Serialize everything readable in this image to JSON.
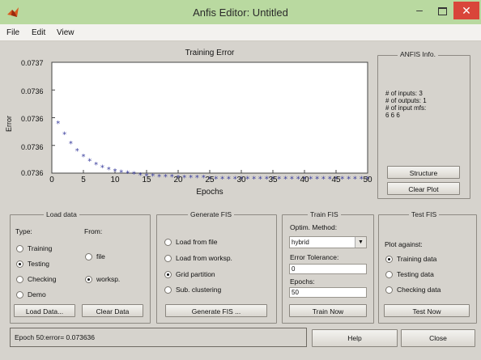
{
  "window": {
    "title": "Anfis Editor: Untitled"
  },
  "menu": [
    "File",
    "Edit",
    "View"
  ],
  "plot": {
    "title": "Training Error",
    "xlabel": "Epochs",
    "ylabel": "Error",
    "ytick_labels": [
      "0.0737",
      "0.0736",
      "0.0736",
      "0.0736",
      "0.0736"
    ],
    "xtick_labels": [
      "0",
      "5",
      "10",
      "15",
      "20",
      "25",
      "30",
      "35",
      "40",
      "45",
      "50"
    ]
  },
  "chart_data": {
    "type": "scatter",
    "title": "Training Error",
    "xlabel": "Epochs",
    "ylabel": "Error",
    "xlim": [
      0,
      50
    ],
    "ylim": [
      0.07358,
      0.0737
    ],
    "x": [
      1,
      2,
      3,
      4,
      5,
      6,
      7,
      8,
      9,
      10,
      11,
      12,
      13,
      14,
      15,
      16,
      17,
      18,
      19,
      20,
      21,
      22,
      23,
      24,
      25,
      26,
      27,
      28,
      29,
      30,
      31,
      32,
      33,
      34,
      35,
      36,
      37,
      38,
      39,
      40,
      41,
      42,
      43,
      44,
      45,
      46,
      47,
      48,
      49,
      50
    ],
    "y": [
      0.073634,
      0.073622,
      0.073612,
      0.073604,
      0.073598,
      0.073593,
      0.073589,
      0.073586,
      0.073584,
      0.073582,
      0.073581,
      0.07358,
      0.073579,
      0.073578,
      0.073577,
      0.073577,
      0.073576,
      0.073576,
      0.073576,
      0.073575,
      0.073575,
      0.073575,
      0.073575,
      0.073575,
      0.073574,
      0.073574,
      0.073574,
      0.073574,
      0.073574,
      0.073574,
      0.073574,
      0.073574,
      0.073574,
      0.073574,
      0.073574,
      0.073574,
      0.073574,
      0.073574,
      0.073574,
      0.073574,
      0.073574,
      0.073574,
      0.073574,
      0.073574,
      0.073574,
      0.073574,
      0.073574,
      0.073574,
      0.073574,
      0.073574
    ],
    "marker": "*",
    "color": "#3b3f9e",
    "grid": false
  },
  "anfis_info": {
    "title": "ANFIS Info.",
    "lines": [
      "# of inputs: 3",
      "# of outputs: 1",
      "# of input mfs:",
      "6 6 6"
    ],
    "structure_label": "Structure",
    "clear_plot_label": "Clear Plot"
  },
  "load_data": {
    "title": "Load data",
    "type_label": "Type:",
    "from_label": "From:",
    "types": [
      "Training",
      "Testing",
      "Checking",
      "Demo"
    ],
    "selected_type": "Testing",
    "from": [
      "file",
      "worksp."
    ],
    "selected_from": "worksp.",
    "load_label": "Load Data...",
    "clear_label": "Clear Data"
  },
  "generate_fis": {
    "title": "Generate FIS",
    "options": [
      "Load from file",
      "Load from worksp.",
      "Grid partition",
      "Sub. clustering"
    ],
    "selected": "Grid partition",
    "button_label": "Generate FIS ..."
  },
  "train_fis": {
    "title": "Train FIS",
    "method_label": "Optim. Method:",
    "method_value": "hybrid",
    "tolerance_label": "Error Tolerance:",
    "tolerance_value": "0",
    "epochs_label": "Epochs:",
    "epochs_value": "50",
    "button_label": "Train Now"
  },
  "test_fis": {
    "title": "Test FIS",
    "plot_against_label": "Plot against:",
    "options": [
      "Training data",
      "Testing data",
      "Checking data"
    ],
    "selected": "Training data",
    "button_label": "Test Now"
  },
  "status": {
    "message": "Epoch 50:error= 0.073636",
    "help_label": "Help",
    "close_label": "Close"
  },
  "colors": {
    "titlebar": "#b9d9a0",
    "close": "#d9453a",
    "marker": "#3b3f9e"
  }
}
